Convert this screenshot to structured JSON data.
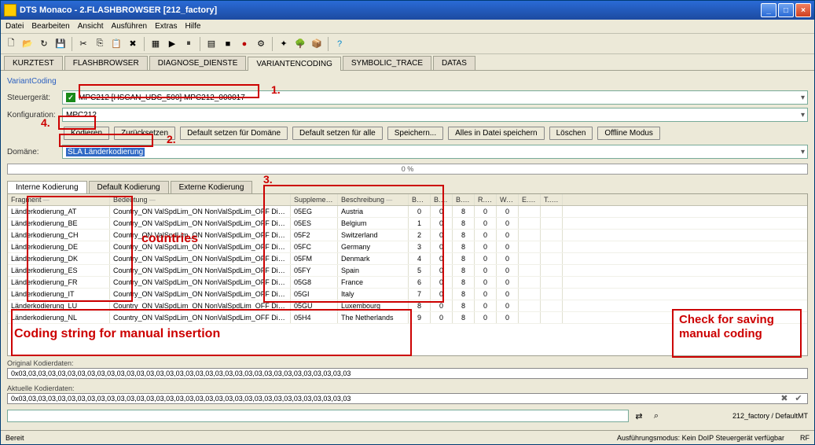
{
  "window": {
    "title": "DTS Monaco - 2.FLASHBROWSER [212_factory]"
  },
  "menu": [
    "Datei",
    "Bearbeiten",
    "Ansicht",
    "Ausführen",
    "Extras",
    "Hilfe"
  ],
  "mainTabs": [
    "KURZTEST",
    "FLASHBROWSER",
    "DIAGNOSE_DIENSTE",
    "VARIANTENCODING",
    "SYMBOLIC_TRACE",
    "DATAS"
  ],
  "mainTabActive": 3,
  "panel": {
    "groupLabel": "VariantCoding",
    "steuergeraet_label": "Steuergerät:",
    "steuergeraet_value": "MPC212 [HSCAN_UDS_500] MPC212_000017",
    "konfiguration_label": "Konfiguration:",
    "konfiguration_value": "MPC212",
    "domaine_label": "Domäne:",
    "domaine_value": "SLA Länderkodierung",
    "progress": "0 %"
  },
  "buttons": {
    "kodieren": "Kodieren",
    "zuruecksetzen": "Zurücksetzen",
    "default_domaine": "Default setzen für Domäne",
    "default_alle": "Default setzen für alle",
    "speichern": "Speichern...",
    "alles_speichern": "Alles in Datei speichern",
    "loeschen": "Löschen",
    "offline": "Offline Modus"
  },
  "innerTabs": [
    "Interne Kodierung",
    "Default Kodierung",
    "Externe Kodierung"
  ],
  "innerTabActive": 0,
  "columns": {
    "fragment": "Fragment",
    "bedeutung": "Bedeutung",
    "supplemen": "Supplemen..",
    "beschreibung": "Beschreibung",
    "byt": "Byt..",
    "b1": "B..",
    "b2": "B..",
    "r": "R..",
    "w": "W..",
    "e": "E..",
    "t": "T.."
  },
  "rows": [
    {
      "frag": "Länderkodierung_AT",
      "bed": "Country_ON ValSpdLim_ON NonValSpdLim_OFF DisableEndOf..",
      "sup": "05EG",
      "besch": "Austria",
      "c": [
        0,
        0,
        8,
        0,
        0
      ]
    },
    {
      "frag": "Länderkodierung_BE",
      "bed": "Country_ON ValSpdLim_ON NonValSpdLim_OFF DisableEndOf..",
      "sup": "05ES",
      "besch": "Belgium",
      "c": [
        1,
        0,
        8,
        0,
        0
      ]
    },
    {
      "frag": "Länderkodierung_CH",
      "bed": "Country_ON ValSpdLim_ON NonValSpdLim_OFF DisableEndOf..",
      "sup": "05F2",
      "besch": "Switzerland",
      "c": [
        2,
        0,
        8,
        0,
        0
      ]
    },
    {
      "frag": "Länderkodierung_DE",
      "bed": "Country_ON ValSpdLim_ON NonValSpdLim_OFF DisableEndOf..",
      "sup": "05FC",
      "besch": "Germany",
      "c": [
        3,
        0,
        8,
        0,
        0
      ]
    },
    {
      "frag": "Länderkodierung_DK",
      "bed": "Country_ON ValSpdLim_ON NonValSpdLim_OFF DisableEndOf..",
      "sup": "05FM",
      "besch": "Denmark",
      "c": [
        4,
        0,
        8,
        0,
        0
      ]
    },
    {
      "frag": "Länderkodierung_ES",
      "bed": "Country_ON ValSpdLim_ON NonValSpdLim_OFF DisableEndOf..",
      "sup": "05FY",
      "besch": "Spain",
      "c": [
        5,
        0,
        8,
        0,
        0
      ]
    },
    {
      "frag": "Länderkodierung_FR",
      "bed": "Country_ON ValSpdLim_ON NonValSpdLim_OFF DisableEndOf..",
      "sup": "05G8",
      "besch": "France",
      "c": [
        6,
        0,
        8,
        0,
        0
      ]
    },
    {
      "frag": "Länderkodierung_IT",
      "bed": "Country_ON ValSpdLim_ON NonValSpdLim_OFF DisableEndOf..",
      "sup": "05GI",
      "besch": "Italy",
      "c": [
        7,
        0,
        8,
        0,
        0
      ]
    },
    {
      "frag": "Länderkodierung_LU",
      "bed": "Country_ON ValSpdLim_ON NonValSpdLim_OFF DisableEndOf..",
      "sup": "05GU",
      "besch": "Luxembourg",
      "c": [
        8,
        0,
        8,
        0,
        0
      ]
    },
    {
      "frag": "Länderkodierung_NL",
      "bed": "Country_ON ValSpdLim_ON NonValSpdLim_OFF DisableEndOf..",
      "sup": "05H4",
      "besch": "The Netherlands",
      "c": [
        9,
        0,
        8,
        0,
        0
      ]
    }
  ],
  "kodier": {
    "original_label": "Original Kodierdaten:",
    "original_value": "0x03,03,03,03,03,03,03,03,03,03,03,03,03,03,03,03,03,03,03,03,03,03,03,03,03,03,03,03,03,03,03,03,03,03",
    "aktuelle_label": "Aktuelle Kodierdaten:",
    "aktuelle_value": "0x03,03,03,03,03,03,03,03,03,03,03,03,03,03,03,03,03,03,03,03,03,03,03,03,03,03,03,03,03,03,03,03,03,03"
  },
  "search": {
    "placeholder": ""
  },
  "statusbar": {
    "bereit": "Bereit",
    "path": "212_factory / DefaultMT",
    "mode": "Ausführungsmodus: Kein DoIP Steuergerät verfügbar",
    "rf": "RF"
  },
  "annotations": {
    "a1": "1.",
    "a2": "2.",
    "a3": "3.",
    "a4": "4.",
    "countries": "countries",
    "coding_string": "Coding string for manual insertion",
    "check_saving": "Check for saving manual  coding"
  }
}
